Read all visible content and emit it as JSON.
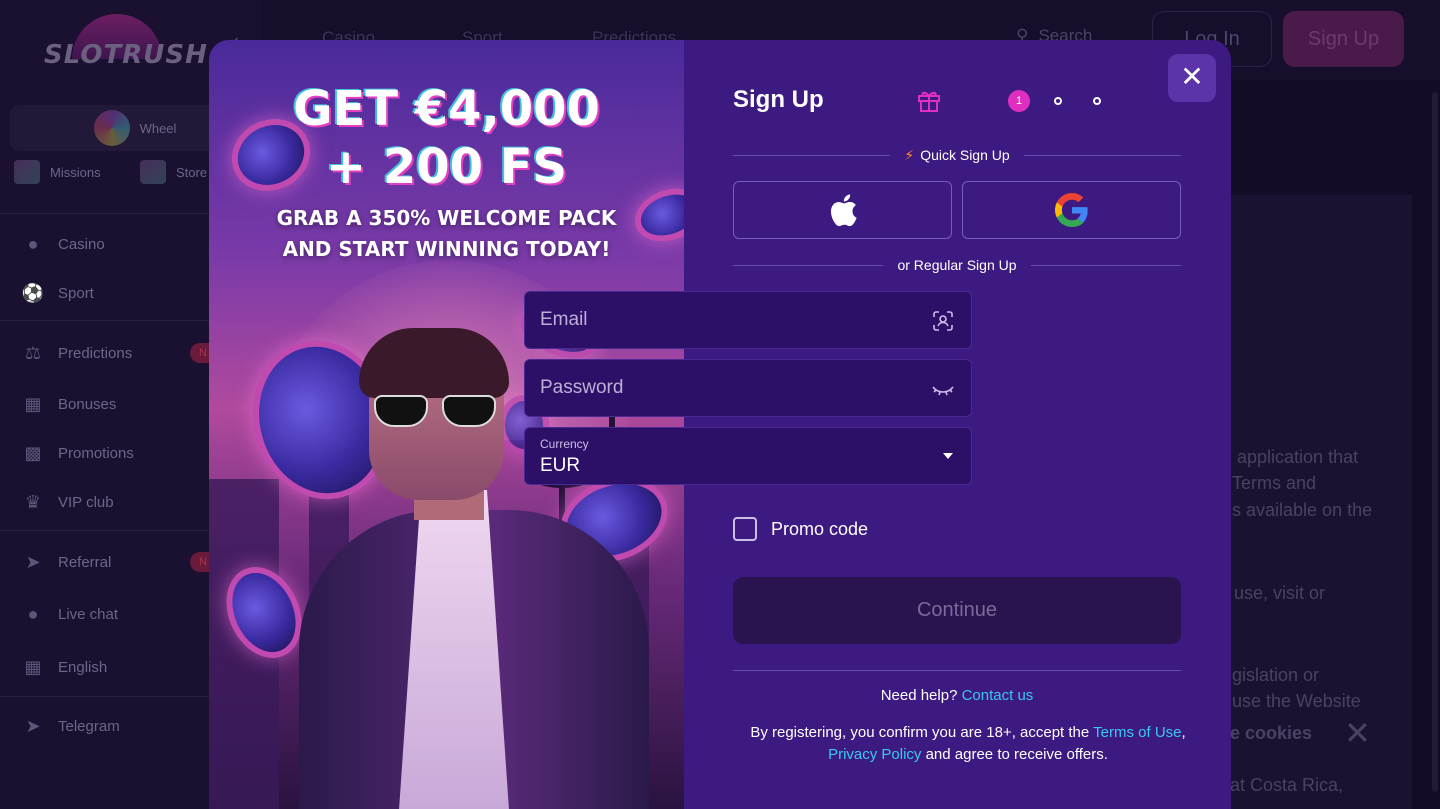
{
  "background": {
    "logo_text": "SLOTRUSH",
    "wheel_label": "Wheel",
    "mini_items": [
      "Missions",
      "Store"
    ],
    "nav": [
      {
        "label": "Casino",
        "icon": "casino-chips-icon"
      },
      {
        "label": "Sport",
        "icon": "ball-icon"
      },
      {
        "label": "Predictions",
        "icon": "scales-icon",
        "badge": "N"
      },
      {
        "label": "Bonuses",
        "icon": "gift-icon"
      },
      {
        "label": "Promotions",
        "icon": "ticket-icon"
      },
      {
        "label": "VIP club",
        "icon": "crown-icon"
      },
      {
        "label": "Referral",
        "icon": "megaphone-icon",
        "badge": "N"
      },
      {
        "label": "Live chat",
        "icon": "chat-icon"
      },
      {
        "label": "English",
        "icon": "uk-flag-icon"
      },
      {
        "label": "Telegram",
        "icon": "telegram-icon"
      }
    ],
    "header_tabs": [
      "Casino",
      "Sport",
      "Predictions"
    ],
    "search_label": "Search",
    "login_label": "Log In",
    "signup_label": "Sign Up",
    "content_lines": [
      "application that",
      "Terms and",
      "s available on the",
      "use, visit or",
      "gislation or",
      "use the Website",
      "at Costa Rica,"
    ],
    "cookie_text": "e cookies"
  },
  "promo": {
    "headline_line1": "GET €4,000",
    "headline_line2": "+ 200 FS",
    "subline1": "GRAB A 350% WELCOME PACK",
    "subline2": "AND START WINNING TODAY!"
  },
  "form": {
    "title": "Sign Up",
    "current_step": "1",
    "quick_signup_label": "Quick Sign Up",
    "regular_signup_label": "or Regular Sign Up",
    "email_placeholder": "Email",
    "password_placeholder": "Password",
    "currency_label": "Currency",
    "currency_value": "EUR",
    "promo_code_label": "Promo code",
    "continue_label": "Continue",
    "help_text": "Need help?",
    "help_link": "Contact us",
    "legal_pre": "By registering, you confirm you are 18+, accept the",
    "legal_terms_link": "Terms of Use",
    "legal_comma": ",",
    "legal_privacy_link": "Privacy Policy",
    "legal_post": "and agree to receive offers."
  },
  "colors": {
    "form_bg": "#3d1a82",
    "field_bg": "#2c0f66",
    "step_active": "#e02ec0",
    "link": "#38c8f0",
    "bolt": "#ff8a2a"
  }
}
